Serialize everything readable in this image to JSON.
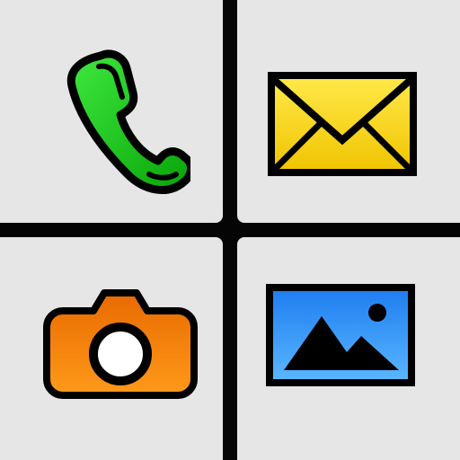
{
  "launcher": {
    "tiles": [
      {
        "id": "phone",
        "icon": "phone-handset-icon",
        "color": "#12c612"
      },
      {
        "id": "messages",
        "icon": "envelope-icon",
        "color": "#ffe100"
      },
      {
        "id": "camera",
        "icon": "camera-icon",
        "color": "#f07a00"
      },
      {
        "id": "gallery",
        "icon": "picture-icon",
        "color": "#2a8cff"
      }
    ]
  }
}
